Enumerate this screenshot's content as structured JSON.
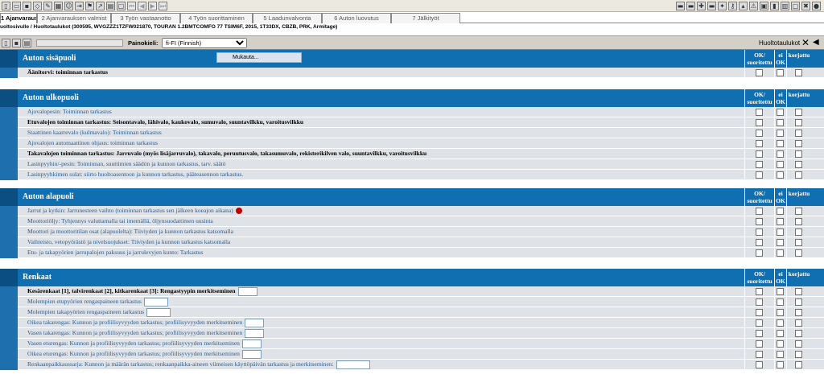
{
  "toolbar": {
    "left_icons": [
      "page-icon",
      "folder-icon",
      "save-icon",
      "tag-icon",
      "edit-icon",
      "table-icon",
      "user-icon",
      "export-icon",
      "flag-icon",
      "trend-icon",
      "print-icon",
      "doc-icon",
      "first-icon",
      "prev-icon",
      "next-icon",
      "last-icon"
    ],
    "right_icons": [
      "car-icon",
      "car-blue-icon",
      "tools-icon",
      "car-green-icon",
      "wrench-icon",
      "key-icon",
      "hammer-icon",
      "warning-icon",
      "box-icon",
      "battery-icon",
      "calendar-icon",
      "document-icon",
      "close-red-icon",
      "globe-icon"
    ]
  },
  "tabs": [
    {
      "label": "1 Ajanvaraus",
      "active": true
    },
    {
      "label": "2 Ajanvarauksen valmist",
      "active": false
    },
    {
      "label": "3 Työn vastaanotto",
      "active": false
    },
    {
      "label": "4 Työn suorittaminen",
      "active": false
    },
    {
      "label": "5 Laadunvalvonta",
      "active": false
    },
    {
      "label": "6 Auton luovutus",
      "active": false
    },
    {
      "label": "7 Jälkityöt",
      "active": false
    }
  ],
  "infobar": "uoltosivulle / Huoltotaulukot (300595, WVGZZZ1TZFW021870, TOURAN 1.2BMTCOMFO 77 TSIM6F, 2015, 1T33DX, CBZB, PRK, Armitage)",
  "options": {
    "print_language_label": "Painokieli:",
    "print_language_value": "fi-FI (Finnish)",
    "right_title": "Huoltotaulukot",
    "dropdown_item": "Mukauta..."
  },
  "columns": {
    "ok": "OK/ suoritettu",
    "not_ok": "ei OK",
    "corrected": "korjattu"
  },
  "sections": [
    {
      "title": "Auton sisäpuoli",
      "rows": [
        {
          "text": "Äänitorvi: toiminnan tarkastus",
          "style": "bold"
        }
      ]
    },
    {
      "title": "Auton ulkopuoli",
      "rows": [
        {
          "text": "Ajovalopesin: Toiminnan tarkastus",
          "style": "link"
        },
        {
          "text": "Etuvalojen toiminnan tarkastus: Seisontavalo, lähivalo, kaukovalo, sumuvalo, suuntavilkku, varoitusvilkku",
          "style": "bold"
        },
        {
          "text": "Staattinen kaarrevalo (kulmavalo): Toiminnan tarkastus",
          "style": "link"
        },
        {
          "text": "Ajovalojen automaattinen ohjaus: toiminnan tarkastus",
          "style": "link"
        },
        {
          "text": "Takavalojen toiminnan tarkastus: Jarruvalo (myös lisäjarruvalo), takavalo, peruutusvalo, takasumuvalo, rekisterikilven valo, suuntavilkku, varoitusvilkku",
          "style": "bold"
        },
        {
          "text": "Lasinpyyhin/-pesin: Toiminnan, suuttimien säädön ja kunnon tarkastus, tarv. säätö",
          "style": "link"
        },
        {
          "text": "Lasinpyyhkimen sulat: siirto huoltoasentoon ja kunnon tarkastus, pääteasennon tarkastus.",
          "style": "link"
        }
      ]
    },
    {
      "title": "Auton alapuoli",
      "rows": [
        {
          "text": "Jarrut ja kytkin: Jarrunesteen vaihto (toiminnan tarkastus sen jälkeen koeajon aikana)",
          "style": "link",
          "dot": true
        },
        {
          "text": "Moottoriöljy: Tyhjennys valuttamalla tai imemällä, öljynsuodattimen uusinta",
          "style": "link"
        },
        {
          "text": "Moottori ja moottoritilan osat (alapuolelta): Tiiviyden ja kunnon tarkastus katsomalla",
          "style": "link"
        },
        {
          "text": "Vaihteisto, vetopyörästö ja nivelsuojukset: Tiiviyden ja kunnon tarkastus katsomalla",
          "style": "link"
        },
        {
          "text": "Etu- ja takapyörien jarrupalojen paksuus ja jarrulevyjen kunto: Tarkastus",
          "style": "link"
        }
      ]
    },
    {
      "title": "Renkaat",
      "rows": [
        {
          "text": "Kesärenkaat [1], talvirenkaat [2], kitkarenkaat [3]: Rengastyypin merkitseminen",
          "style": "bold",
          "input": true
        },
        {
          "text": "Molempien etupyörien rengaspaineen tarkastus",
          "style": "link",
          "input": true
        },
        {
          "text": "Molempien takapyörien rengaspaineen tarkastus",
          "style": "link",
          "input": true
        },
        {
          "text": "Oikea takarengas: Kunnon ja profiilisyvyyden tarkastus; profiilisyvyyden merkitseminen",
          "style": "link",
          "input": true
        },
        {
          "text": "Vasen takarengas: Kunnon ja profiilisyvyyden tarkastus; profiilisyvyyden merkitseminen",
          "style": "link",
          "input": true
        },
        {
          "text": "Vasen eturengas: Kunnon ja profiilisyvyyden tarkastus; profiilisyvyyden merkitseminen",
          "style": "link",
          "input": true
        },
        {
          "text": "Oikea eturengas: Kunnon ja profiilisyvyyden tarkastus; profiilisyvyyden merkitseminen",
          "style": "link",
          "input": true
        },
        {
          "text": "Renkaanpaikkaussarja: Kunnon ja määrän tarkastus; renkaanpaikka-aineen viimeisen käyttöpäivän tarkastus ja merkitseminen:",
          "style": "link",
          "input": true
        }
      ]
    }
  ]
}
